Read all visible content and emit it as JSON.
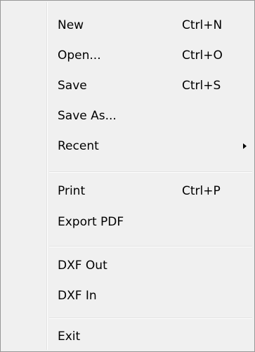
{
  "menu": {
    "items": [
      {
        "label": "New",
        "shortcut": "Ctrl+N"
      },
      {
        "label": "Open...",
        "shortcut": "Ctrl+O"
      },
      {
        "label": "Save",
        "shortcut": "Ctrl+S"
      },
      {
        "label": "Save As...",
        "shortcut": ""
      },
      {
        "label": "Recent",
        "shortcut": "",
        "submenu_icon": "chevron-right-icon"
      },
      {
        "label": "Print",
        "shortcut": "Ctrl+P"
      },
      {
        "label": "Export PDF",
        "shortcut": ""
      },
      {
        "label": "DXF Out",
        "shortcut": ""
      },
      {
        "label": "DXF In",
        "shortcut": ""
      },
      {
        "label": "Exit",
        "shortcut": ""
      }
    ]
  },
  "colors": {
    "menu_background": "#f0f0f0",
    "border": "#979797",
    "separator": "#e2e3e3",
    "text": "#000000"
  }
}
